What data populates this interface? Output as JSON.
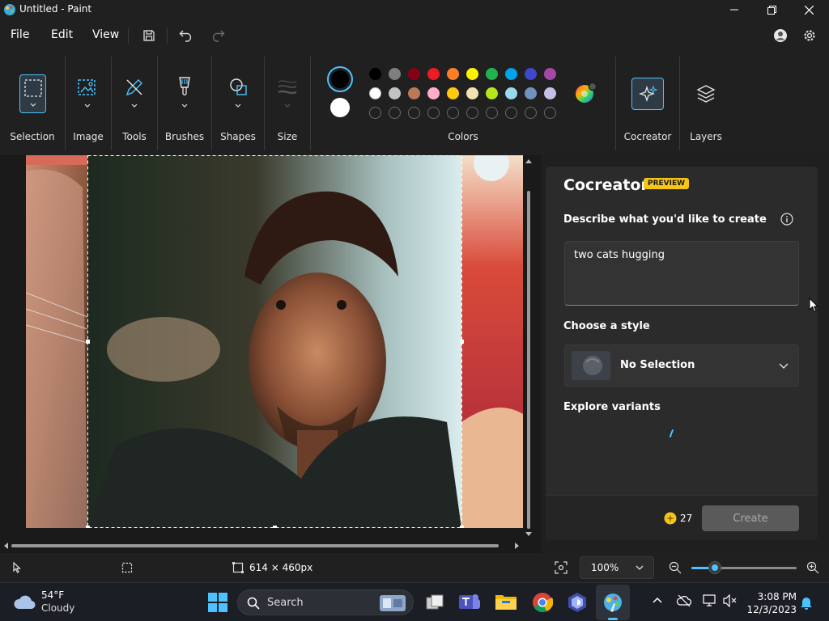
{
  "window": {
    "title": "Untitled - Paint"
  },
  "menu": {
    "file": "File",
    "edit": "Edit",
    "view": "View"
  },
  "ribbon": {
    "selection": "Selection",
    "image": "Image",
    "tools": "Tools",
    "brushes": "Brushes",
    "shapes": "Shapes",
    "size": "Size",
    "colors": "Colors",
    "cocreator": "Cocreator",
    "layers": "Layers",
    "palette_row1": [
      "#000000",
      "#7f7f7f",
      "#880015",
      "#ed1c24",
      "#ff7f27",
      "#fff200",
      "#22b14c",
      "#00a2e8",
      "#3f48cc",
      "#a349a4"
    ],
    "palette_row2": [
      "#ffffff",
      "#c3c3c3",
      "#b97a57",
      "#ffaec9",
      "#ffc90e",
      "#efe4b0",
      "#b5e61d",
      "#99d9ea",
      "#7092be",
      "#c8bfe7"
    ],
    "primary_color": "#000000",
    "secondary_color": "#ffffff"
  },
  "cocreator": {
    "title": "Cocreator",
    "badge": "PREVIEW",
    "describe_label": "Describe what you'd like to create",
    "prompt_value": "two cats hugging",
    "style_label": "Choose a style",
    "style_value": "No Selection",
    "variants_label": "Explore variants",
    "credits": "27",
    "create_label": "Create"
  },
  "status": {
    "canvas_size": "614 × 460px",
    "zoom": "100%",
    "zoom_level": 0.18
  },
  "taskbar": {
    "weather_temp": "54°F",
    "weather_desc": "Cloudy",
    "search_label": "Search",
    "time": "3:08 PM",
    "date": "12/3/2023"
  },
  "colors": {
    "accent": "#4cc2ff",
    "badge": "#f5c518",
    "panel": "#2b2b2b"
  }
}
